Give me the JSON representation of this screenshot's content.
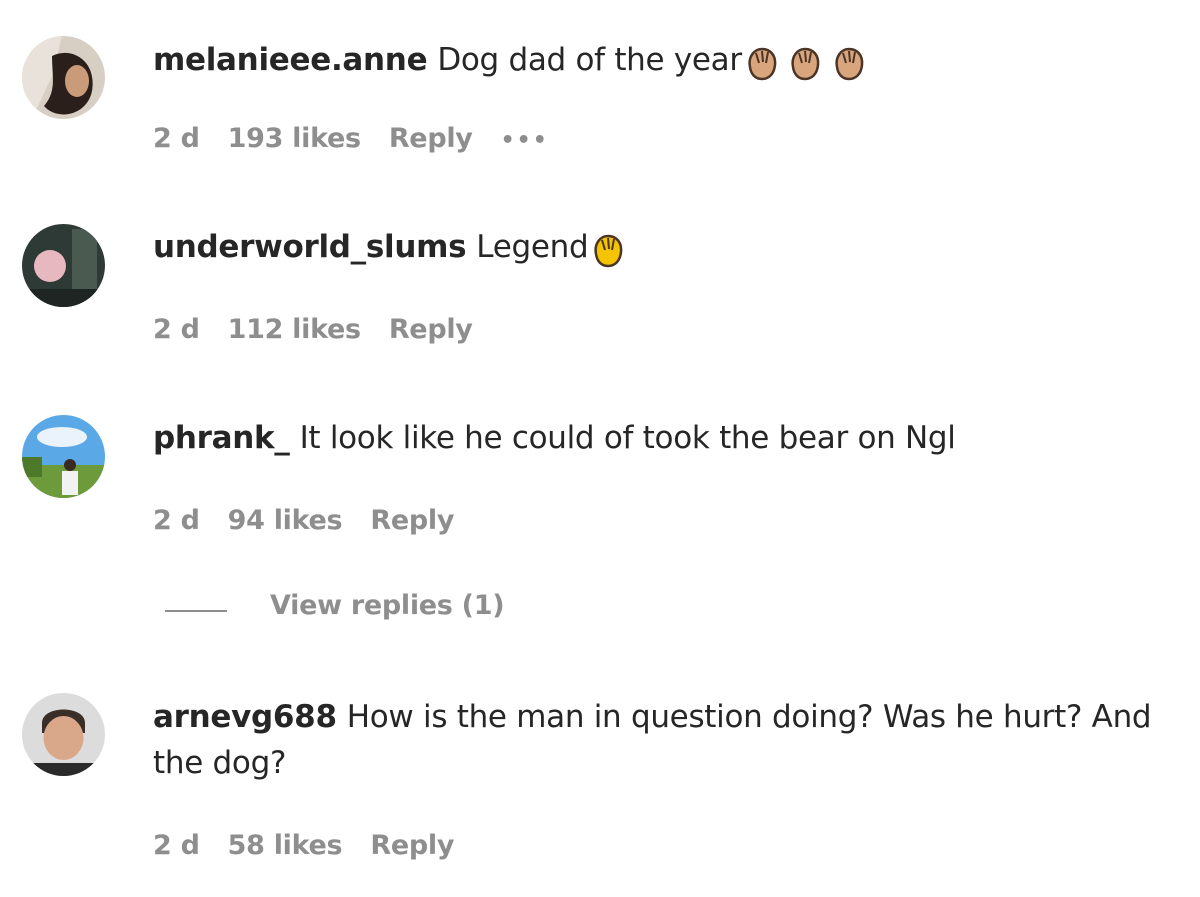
{
  "comments": [
    {
      "username": "melanieee.anne",
      "text": "Dog dad of the year",
      "emoji": "clapping-hands x3",
      "time": "2 d",
      "likes": "193 likes",
      "reply": "Reply",
      "more": "•••"
    },
    {
      "username": "underworld_slums",
      "text": "Legend",
      "emoji": "clapping-hands",
      "time": "2 d",
      "likes": "112 likes",
      "reply": "Reply"
    },
    {
      "username": "phrank_",
      "text": "It look like he could of took the bear on Ngl",
      "time": "2 d",
      "likes": "94 likes",
      "reply": "Reply",
      "view_replies": "View replies (1)"
    },
    {
      "username": "arnevg688",
      "text": "How is the man in question doing? Was he hurt? And the dog?",
      "time": "2 d",
      "likes": "58 likes",
      "reply": "Reply"
    }
  ],
  "colors": {
    "text": "#262626",
    "meta": "#8e8e8e",
    "clap_light": "#d9a57c",
    "clap_yellow": "#f5c400"
  }
}
